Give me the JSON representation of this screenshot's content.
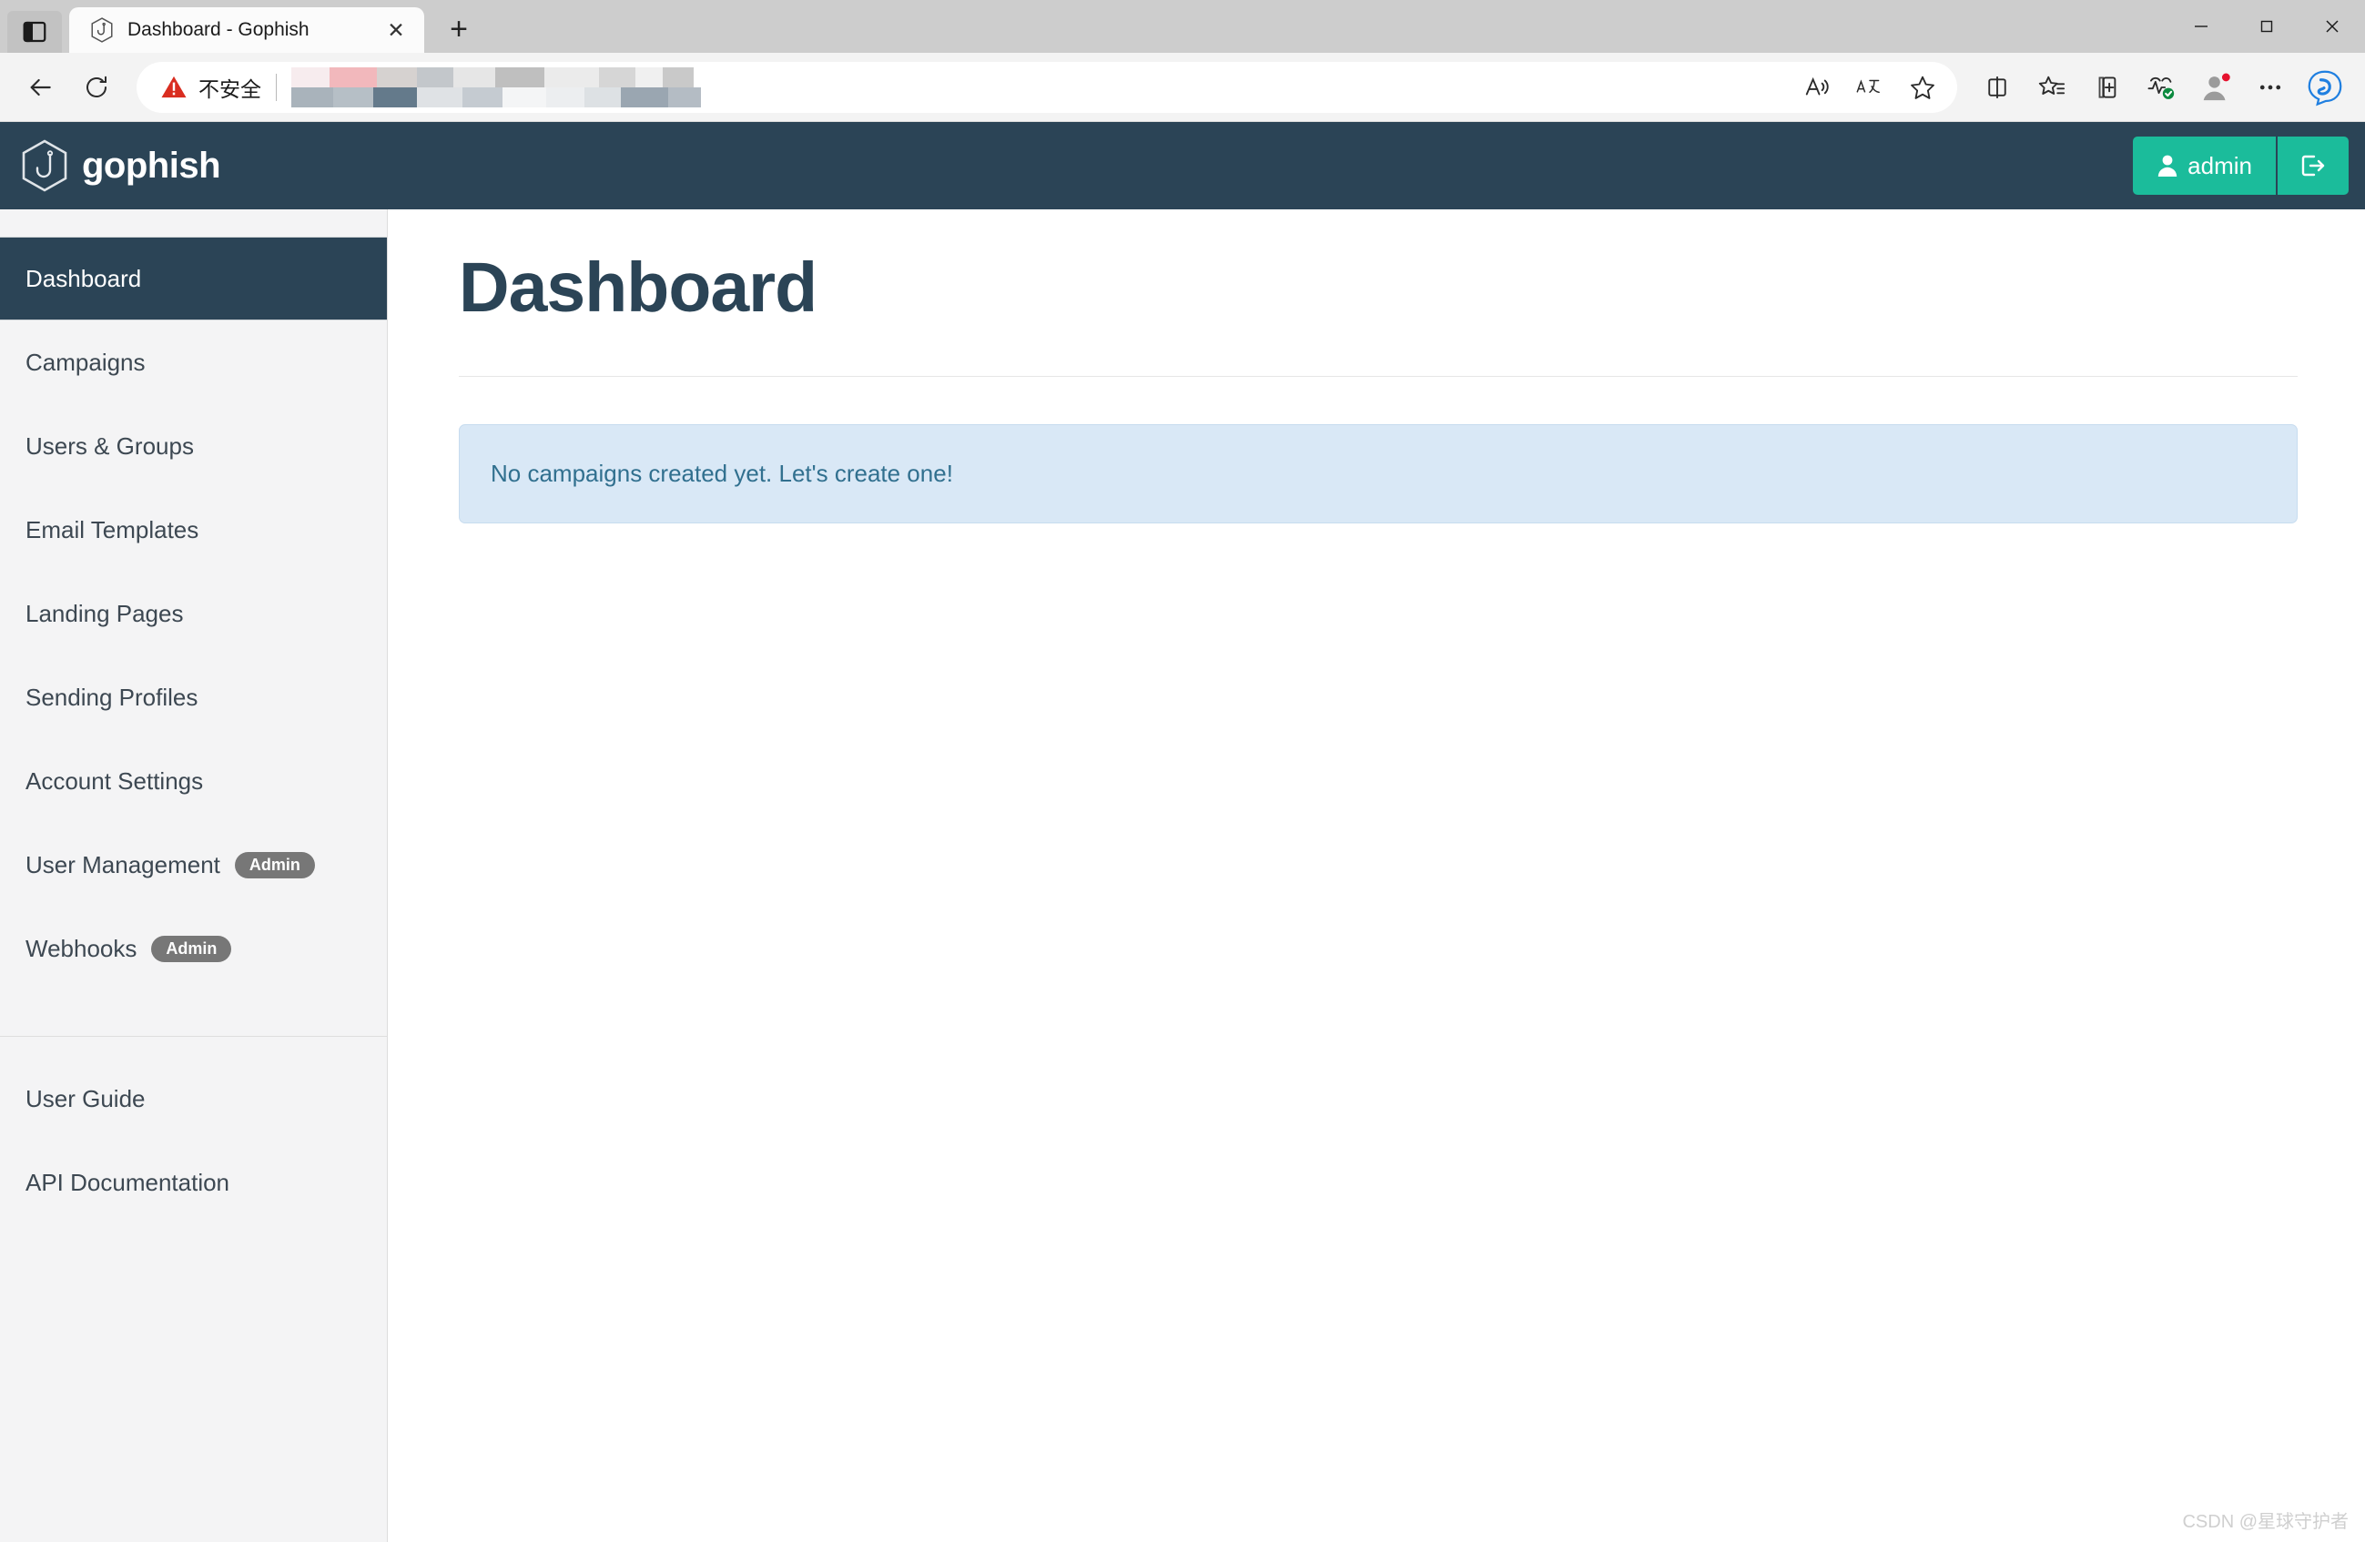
{
  "browser": {
    "tab_actions_icon": "vertical-tabs-icon",
    "tab": {
      "favicon": "gophish-favicon",
      "title": "Dashboard - Gophish",
      "close_label": "✕"
    },
    "new_tab_label": "+",
    "window_controls": {
      "minimize": "—",
      "maximize": "☐",
      "close": "✕"
    },
    "toolbar": {
      "back_icon": "back-arrow-icon",
      "reload_icon": "reload-icon",
      "security_warning": "不安全",
      "url_value": "",
      "url_placeholder": "",
      "read_aloud_icon": "read-aloud-icon",
      "translate_icon": "translate-icon",
      "favorite_icon": "star-icon",
      "split_screen_icon": "split-screen-icon",
      "favorites_icon": "favorites-list-icon",
      "collections_icon": "add-to-collections-icon",
      "browser_essentials_icon": "browser-essentials-icon",
      "profile_icon": "profile-avatar-icon",
      "settings_icon": "more-options-icon",
      "copilot_icon": "copilot-icon"
    }
  },
  "navbar": {
    "logo_icon": "gophish-hook-logo",
    "brand": "gophish",
    "user_icon": "user-icon",
    "user_label": "admin",
    "logout_icon": "logout-icon"
  },
  "sidebar": {
    "items": [
      {
        "label": "Dashboard",
        "badge": "",
        "active": true
      },
      {
        "label": "Campaigns",
        "badge": "",
        "active": false
      },
      {
        "label": "Users & Groups",
        "badge": "",
        "active": false
      },
      {
        "label": "Email Templates",
        "badge": "",
        "active": false
      },
      {
        "label": "Landing Pages",
        "badge": "",
        "active": false
      },
      {
        "label": "Sending Profiles",
        "badge": "",
        "active": false
      },
      {
        "label": "Account Settings",
        "badge": "",
        "active": false
      },
      {
        "label": "User Management",
        "badge": "Admin",
        "active": false
      },
      {
        "label": "Webhooks",
        "badge": "Admin",
        "active": false
      }
    ],
    "footer_items": [
      {
        "label": "User Guide"
      },
      {
        "label": "API Documentation"
      }
    ]
  },
  "main": {
    "title": "Dashboard",
    "alert_text": "No campaigns created yet. Let's create one!"
  },
  "watermark": "CSDN @星球守护者",
  "colors": {
    "navy": "#2b4456",
    "teal": "#1bbc9b",
    "sidebar_bg": "#f4f4f5",
    "alert_bg": "#d9e8f6",
    "alert_text": "#31708f",
    "badge_gray": "#777777",
    "warning_red": "#d92d20"
  }
}
